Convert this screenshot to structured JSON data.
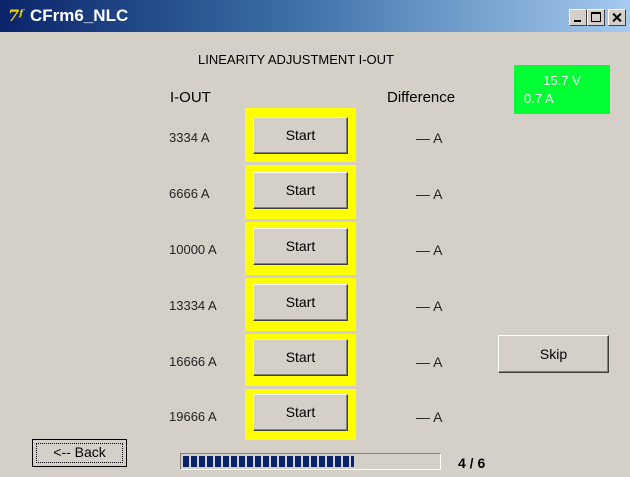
{
  "window": {
    "title": "CFrm6_NLC",
    "icon": "app-logo-icon"
  },
  "heading": "LINEARITY ADJUSTMENT I-OUT",
  "columns": {
    "iout": "I-OUT",
    "difference": "Difference"
  },
  "readout": {
    "voltage": "15.7 V",
    "current": "0.7 A",
    "background": "#00ff33"
  },
  "rows": [
    {
      "iout": "3334 A",
      "button": "Start",
      "difference": "— A"
    },
    {
      "iout": "6666 A",
      "button": "Start",
      "difference": "— A"
    },
    {
      "iout": "10000 A",
      "button": "Start",
      "difference": "— A"
    },
    {
      "iout": "13334 A",
      "button": "Start",
      "difference": "— A"
    },
    {
      "iout": "16666 A",
      "button": "Start",
      "difference": "— A"
    },
    {
      "iout": "19666 A",
      "button": "Start",
      "difference": "— A"
    }
  ],
  "skip_label": "Skip",
  "back_label": "<-- Back",
  "progress": {
    "fraction": 0.67,
    "text": "4 / 6"
  },
  "colors": {
    "highlight": "#ffff00",
    "progress": "#0a246a",
    "titlebar": "#0a246a"
  }
}
